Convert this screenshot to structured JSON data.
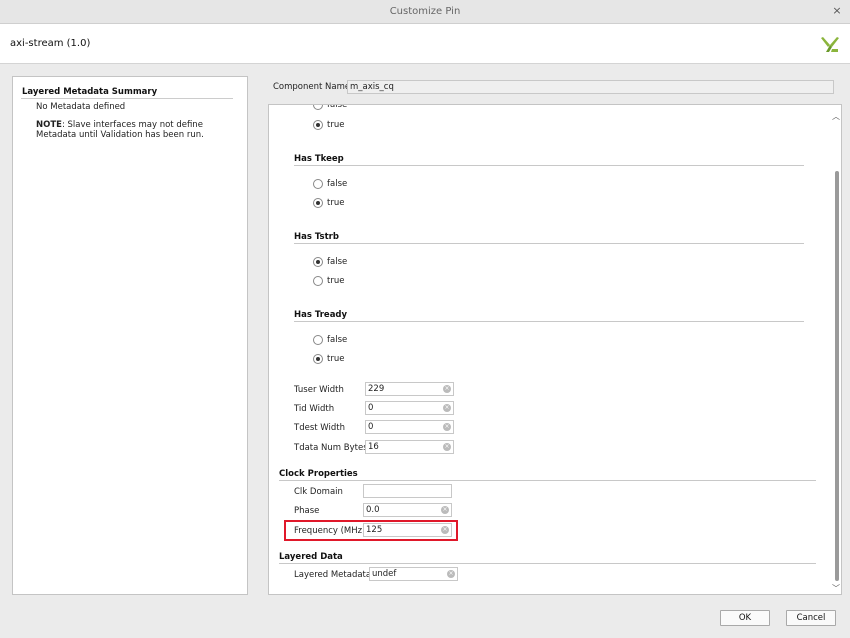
{
  "window": {
    "title": "Customize Pin",
    "close": "×"
  },
  "header": {
    "ip_name": "axi-stream (1.0)"
  },
  "left_panel": {
    "title": "Layered Metadata Summary",
    "no_metadata": "No Metadata defined",
    "note_label": "NOTE",
    "note_text": ": Slave interfaces may not define Metadata until Validation has been run."
  },
  "component": {
    "label": "Component Name",
    "value": "m_axis_cq"
  },
  "partial_top": {
    "hidden_option": "false",
    "selected_option": "true"
  },
  "groups": [
    {
      "title": "Has Tkeep",
      "options": [
        "false",
        "true"
      ],
      "selected": "true"
    },
    {
      "title": "Has Tstrb",
      "options": [
        "false",
        "true"
      ],
      "selected": "false"
    },
    {
      "title": "Has Tready",
      "options": [
        "false",
        "true"
      ],
      "selected": "true"
    }
  ],
  "fields": [
    {
      "label": "Tuser Width",
      "value": "229"
    },
    {
      "label": "Tid Width",
      "value": "0"
    },
    {
      "label": "Tdest Width",
      "value": "0"
    },
    {
      "label": "Tdata Num Bytes",
      "value": "16"
    }
  ],
  "clock": {
    "title": "Clock Properties",
    "domain_label": "Clk Domain",
    "domain_value": "",
    "phase_label": "Phase",
    "phase_value": "0.0",
    "freq_label": "Frequency (MHz)",
    "freq_value": "125"
  },
  "layered": {
    "title": "Layered Data",
    "meta_label": "Layered Metadata",
    "meta_value": "undef"
  },
  "buttons": {
    "ok": "OK",
    "cancel": "Cancel"
  },
  "colors": {
    "highlight": "#e0182a",
    "logo": "#8bb53c"
  },
  "icons": {
    "clear": "clear-circle-icon",
    "logo": "xilinx-logo-icon",
    "scroll_up": "chevron-up-icon",
    "scroll_down": "chevron-down-icon"
  }
}
